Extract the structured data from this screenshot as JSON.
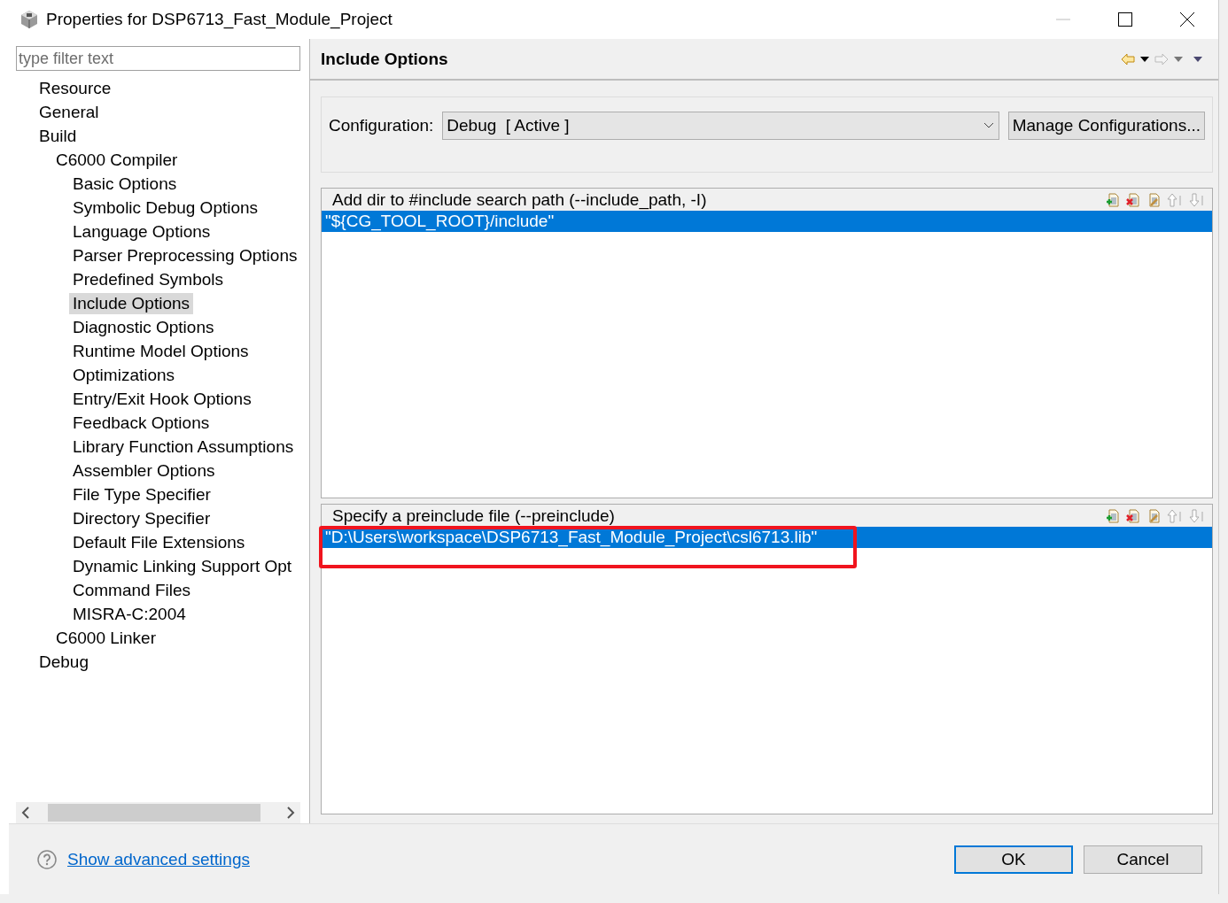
{
  "window": {
    "title": "Properties for DSP6713_Fast_Module_Project"
  },
  "filter": {
    "placeholder": "type filter text"
  },
  "tree": [
    {
      "label": "Resource",
      "selected": false
    },
    {
      "label": "General",
      "selected": false
    },
    {
      "label": "Build",
      "selected": false,
      "children": [
        {
          "label": "C6000 Compiler",
          "selected": false,
          "children": [
            {
              "label": "Basic Options",
              "selected": false
            },
            {
              "label": "Symbolic Debug Options",
              "selected": false
            },
            {
              "label": "Language Options",
              "selected": false
            },
            {
              "label": "Parser Preprocessing Options",
              "selected": false
            },
            {
              "label": "Predefined Symbols",
              "selected": false
            },
            {
              "label": "Include Options",
              "selected": true
            },
            {
              "label": "Diagnostic Options",
              "selected": false
            },
            {
              "label": "Runtime Model Options",
              "selected": false
            },
            {
              "label": "Optimizations",
              "selected": false
            },
            {
              "label": "Entry/Exit Hook Options",
              "selected": false
            },
            {
              "label": "Feedback Options",
              "selected": false
            },
            {
              "label": "Library Function Assumptions",
              "selected": false
            },
            {
              "label": "Assembler Options",
              "selected": false
            },
            {
              "label": "File Type Specifier",
              "selected": false
            },
            {
              "label": "Directory Specifier",
              "selected": false
            },
            {
              "label": "Default File Extensions",
              "selected": false
            },
            {
              "label": "Dynamic Linking Support Opt",
              "selected": false
            },
            {
              "label": "Command Files",
              "selected": false
            },
            {
              "label": "MISRA-C:2004",
              "selected": false
            }
          ]
        },
        {
          "label": "C6000 Linker",
          "selected": false
        }
      ]
    },
    {
      "label": "Debug",
      "selected": false
    }
  ],
  "page": {
    "title": "Include Options"
  },
  "configuration": {
    "label": "Configuration:",
    "value": "Debug  [ Active ]",
    "manage_button": "Manage Configurations..."
  },
  "lists": [
    {
      "title": "Add dir to #include search path (--include_path, -I)",
      "highlighted": false,
      "items": [
        {
          "text": "\"${CG_TOOL_ROOT}/include\"",
          "selected": true
        }
      ]
    },
    {
      "title": "Specify a preinclude file (--preinclude)",
      "highlighted": true,
      "items": [
        {
          "text": "\"D:\\Users\\workspace\\DSP6713_Fast_Module_Project\\csl6713.lib\"",
          "selected": true
        }
      ]
    }
  ],
  "footer": {
    "link": "Show advanced settings",
    "buttons": [
      {
        "label": "OK",
        "default": true
      },
      {
        "label": "Cancel",
        "default": false
      }
    ]
  }
}
